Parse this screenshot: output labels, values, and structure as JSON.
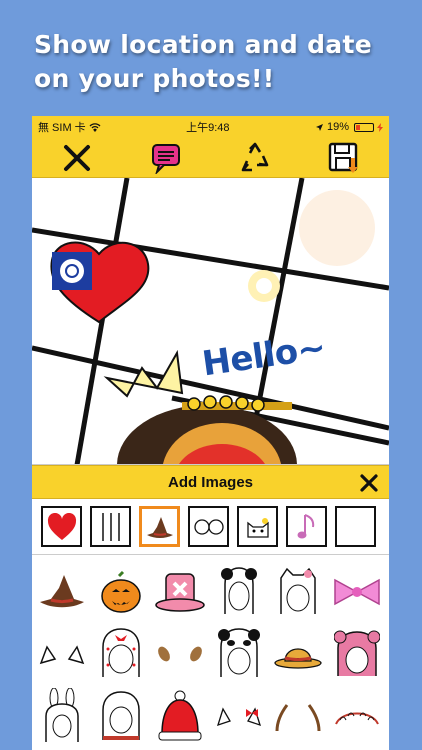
{
  "headline": {
    "line1": "Show location and date",
    "line2": "on your photos!!"
  },
  "status_bar": {
    "carrier": "無 SIM 卡",
    "time": "上午9:48",
    "battery": "19%"
  },
  "toolbar": {
    "close_icon": "close-icon",
    "text_icon": "speech-bubble-icon",
    "recycle_icon": "recycle-icon",
    "save_icon": "save-icon"
  },
  "canvas": {
    "sticker_text": "Hello~"
  },
  "panel": {
    "title": "Add Images"
  },
  "categories": [
    "heart",
    "lines",
    "witch-hat",
    "glasses",
    "cat-face",
    "music-note",
    "more"
  ],
  "stickers": [
    "witch-hat",
    "pumpkin",
    "chopper-hat",
    "panda-hood",
    "cat-hood",
    "pink-bow",
    "cat-ears",
    "strawberry-hood",
    "deer-ears",
    "panda-face-hood",
    "straw-hat",
    "bear-hood",
    "bunny-hood",
    "red-hood",
    "santa-hat",
    "red-bow-ears",
    "antlers",
    "maid-headband"
  ],
  "colors": {
    "accent": "#f9d22b",
    "background": "#6f9bdb",
    "hello_text": "#1d4fa7"
  }
}
